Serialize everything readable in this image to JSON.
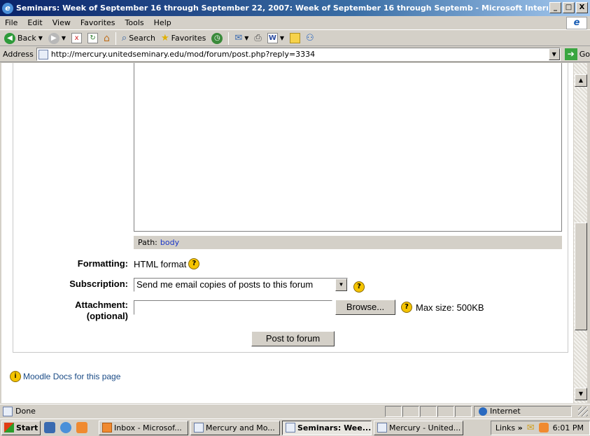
{
  "window": {
    "title": "Seminars: Week of September 16 through September 22, 2007: Week of September 16 through Septemb - Microsoft Internet ...",
    "controls": {
      "minimize": "_",
      "maximize": "□",
      "close": "X"
    }
  },
  "menu": [
    "File",
    "Edit",
    "View",
    "Favorites",
    "Tools",
    "Help"
  ],
  "toolbar": {
    "back_label": "Back",
    "search_label": "Search",
    "favorites_label": "Favorites"
  },
  "address": {
    "label": "Address",
    "url": "http://mercury.unitedseminary.edu/mod/forum/post.php?reply=3334",
    "go_label": "Go"
  },
  "editor": {
    "path_label": "Path:",
    "path_value": "body"
  },
  "form": {
    "formatting_label": "Formatting:",
    "formatting_value": "HTML format",
    "subscription_label": "Subscription:",
    "subscription_value": "Send me email copies of posts to this forum",
    "attachment_label_1": "Attachment:",
    "attachment_label_2": "(optional)",
    "attachment_value": "",
    "browse_label": "Browse...",
    "max_size": "Max size: 500KB",
    "submit_label": "Post to forum",
    "help_glyph": "?"
  },
  "docs_link": "Moodle Docs for this page",
  "status": {
    "text": "Done",
    "zone": "Internet"
  },
  "taskbar": {
    "start_label": "Start",
    "tasks": [
      {
        "label": "Inbox - Microsof...",
        "active": false
      },
      {
        "label": "Mercury and Mo...",
        "active": false
      },
      {
        "label": "Seminars: Wee...",
        "active": true
      },
      {
        "label": "Mercury - United...",
        "active": false
      }
    ],
    "links_label": "Links",
    "links_chevron": "»",
    "clock": "6:01 PM"
  },
  "icons": {
    "window": "ie-page-icon",
    "help": "help-icon",
    "info": "info-icon",
    "go": "go-arrow-icon"
  }
}
